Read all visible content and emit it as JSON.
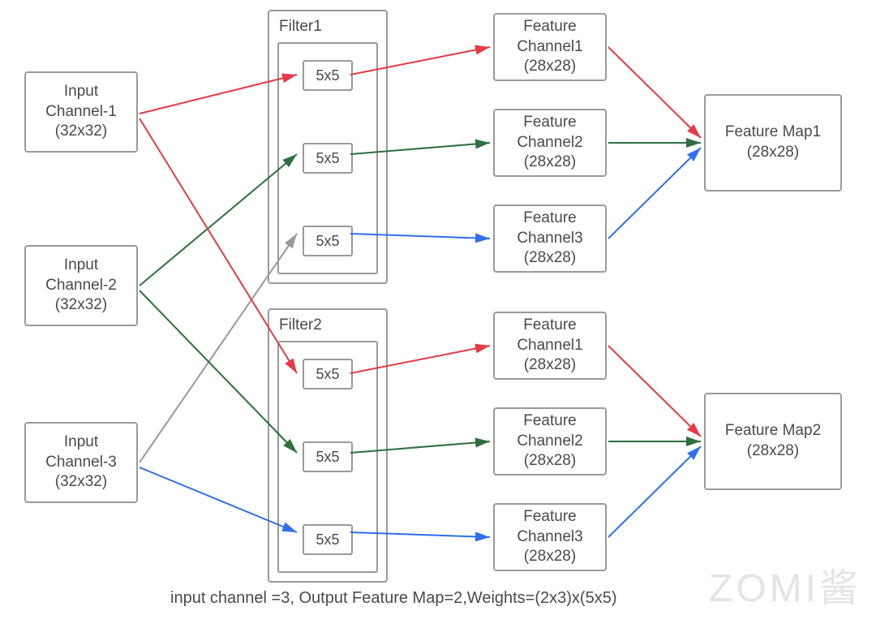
{
  "inputs": [
    {
      "line1": "Input",
      "line2": "Channel-1",
      "line3": "(32x32)"
    },
    {
      "line1": "Input",
      "line2": "Channel-2",
      "line3": "(32x32)"
    },
    {
      "line1": "Input",
      "line2": "Channel-3",
      "line3": "(32x32)"
    }
  ],
  "filters": [
    {
      "title": "Filter1",
      "kernels": [
        "5x5",
        "5x5",
        "5x5"
      ]
    },
    {
      "title": "Filter2",
      "kernels": [
        "5x5",
        "5x5",
        "5x5"
      ]
    }
  ],
  "features": [
    {
      "line1": "Feature",
      "line2": "Channel1",
      "line3": "(28x28)"
    },
    {
      "line1": "Feature",
      "line2": "Channel2",
      "line3": "(28x28)"
    },
    {
      "line1": "Feature",
      "line2": "Channel3",
      "line3": "(28x28)"
    },
    {
      "line1": "Feature",
      "line2": "Channel1",
      "line3": "(28x28)"
    },
    {
      "line1": "Feature",
      "line2": "Channel2",
      "line3": "(28x28)"
    },
    {
      "line1": "Feature",
      "line2": "Channel3",
      "line3": "(28x28)"
    }
  ],
  "outputs": [
    {
      "line1": "Feature Map1",
      "line2": "(28x28)"
    },
    {
      "line1": "Feature Map2",
      "line2": "(28x28)"
    }
  ],
  "caption": "input channel =3, Output Feature Map=2,Weights=(2x3)x(5x5)",
  "watermark": "ZOMI酱",
  "colors": {
    "red": "#e63946",
    "green": "#2e6f3e",
    "blue": "#2f6fed",
    "gray": "#9a9a9a"
  },
  "chart_data": {
    "type": "diagram",
    "description": "Convolution mapping: 3 input channels × 2 filters (each with 3 kernels of 5x5) → 6 feature channels → summed into 2 feature maps",
    "input_channels": 3,
    "output_feature_maps": 2,
    "kernel_size": [
      5,
      5
    ],
    "input_size": [
      32,
      32
    ],
    "feature_size": [
      28,
      28
    ],
    "weights_shape": "(2x3)x(5x5)",
    "edges": [
      {
        "from": "InputChannel1",
        "to": "Filter1.k1",
        "color": "red"
      },
      {
        "from": "InputChannel2",
        "to": "Filter1.k2",
        "color": "green"
      },
      {
        "from": "InputChannel3",
        "to": "Filter1.k3",
        "color": "gray"
      },
      {
        "from": "InputChannel1",
        "to": "Filter2.k1",
        "color": "red"
      },
      {
        "from": "InputChannel2",
        "to": "Filter2.k2",
        "color": "green"
      },
      {
        "from": "InputChannel3",
        "to": "Filter2.k3",
        "color": "blue"
      },
      {
        "from": "Filter1.k1",
        "to": "FeatureCh1a",
        "color": "red"
      },
      {
        "from": "Filter1.k2",
        "to": "FeatureCh2a",
        "color": "green"
      },
      {
        "from": "Filter1.k3",
        "to": "FeatureCh3a",
        "color": "blue"
      },
      {
        "from": "Filter2.k1",
        "to": "FeatureCh1b",
        "color": "red"
      },
      {
        "from": "Filter2.k2",
        "to": "FeatureCh2b",
        "color": "green"
      },
      {
        "from": "Filter2.k3",
        "to": "FeatureCh3b",
        "color": "blue"
      },
      {
        "from": "FeatureCh1a",
        "to": "FeatureMap1",
        "color": "red"
      },
      {
        "from": "FeatureCh2a",
        "to": "FeatureMap1",
        "color": "green"
      },
      {
        "from": "FeatureCh3a",
        "to": "FeatureMap1",
        "color": "blue"
      },
      {
        "from": "FeatureCh1b",
        "to": "FeatureMap2",
        "color": "red"
      },
      {
        "from": "FeatureCh2b",
        "to": "FeatureMap2",
        "color": "green"
      },
      {
        "from": "FeatureCh3b",
        "to": "FeatureMap2",
        "color": "blue"
      }
    ]
  }
}
